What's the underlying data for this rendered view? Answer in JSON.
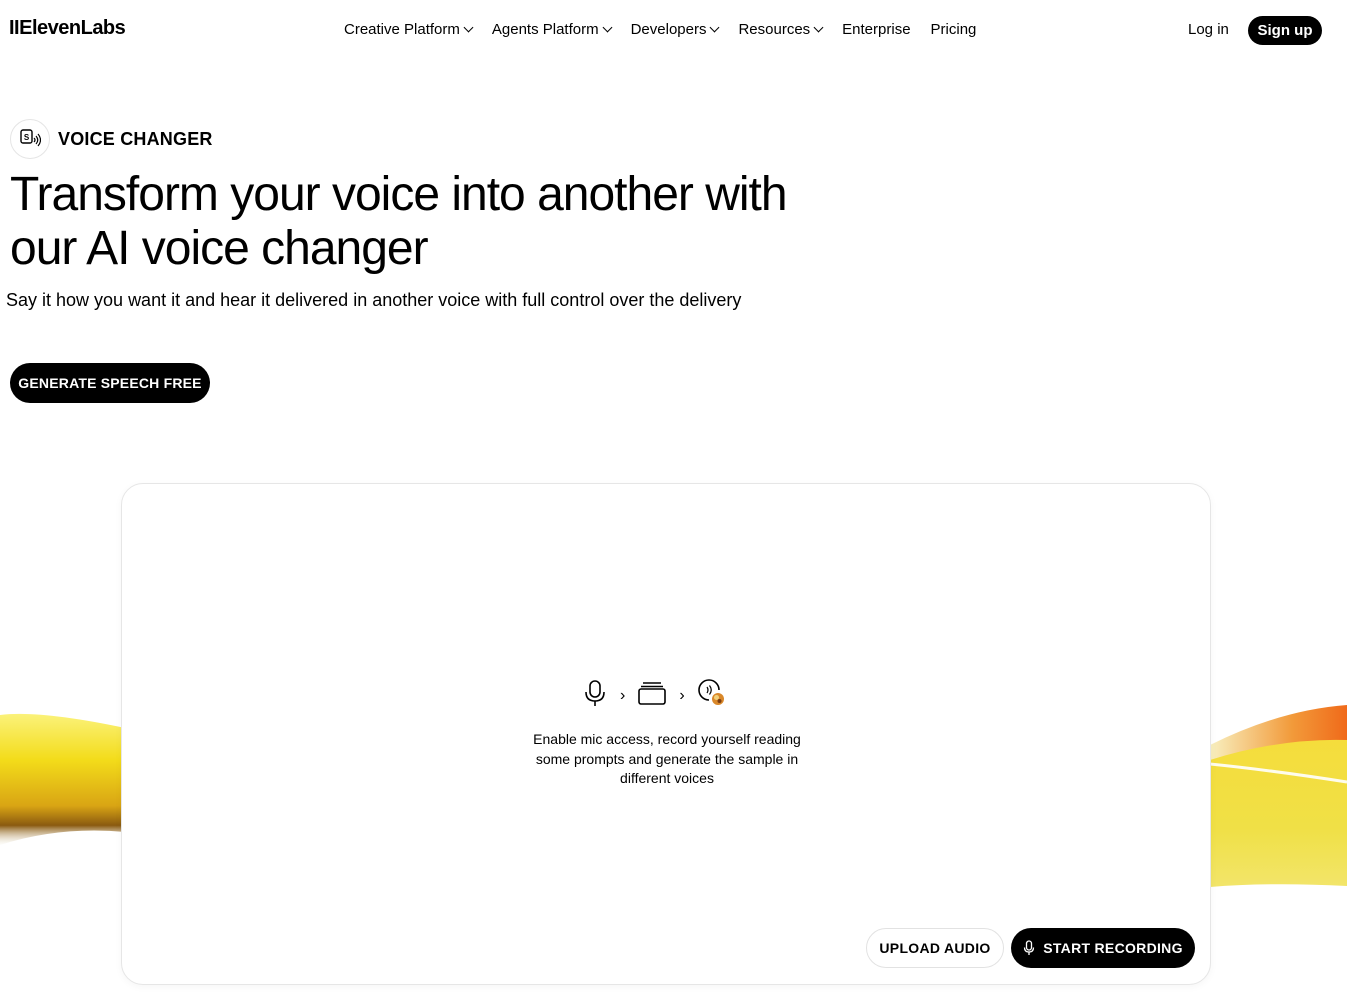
{
  "nav": {
    "logo": "IIElevenLabs",
    "items": [
      {
        "label": "Creative Platform",
        "dropdown": true
      },
      {
        "label": "Agents Platform",
        "dropdown": true
      },
      {
        "label": "Developers",
        "dropdown": true
      },
      {
        "label": "Resources",
        "dropdown": true
      },
      {
        "label": "Enterprise",
        "dropdown": false
      },
      {
        "label": "Pricing",
        "dropdown": false
      }
    ],
    "login": "Log in",
    "signup": "Sign up"
  },
  "hero": {
    "badge_icon": "voice-changer-icon",
    "badge_label": "VOICE CHANGER",
    "title": "Transform your voice into another with our AI voice changer",
    "subtitle": "Say it how you want it and hear it delivered in another voice with full control over the delivery",
    "cta": "GENERATE SPEECH FREE"
  },
  "card": {
    "flow_icons": [
      "microphone-icon",
      "cards-icon",
      "voice-avatar-icon"
    ],
    "arrow": "›",
    "description": "Enable mic access, record yourself reading some prompts and generate the sample in different voices",
    "upload_label": "UPLOAD AUDIO",
    "record_label": "START RECORDING"
  },
  "colors": {
    "primary": "#000000",
    "background": "#ffffff",
    "accent_yellow": "#f5d90a",
    "accent_orange": "#f07a1a"
  }
}
